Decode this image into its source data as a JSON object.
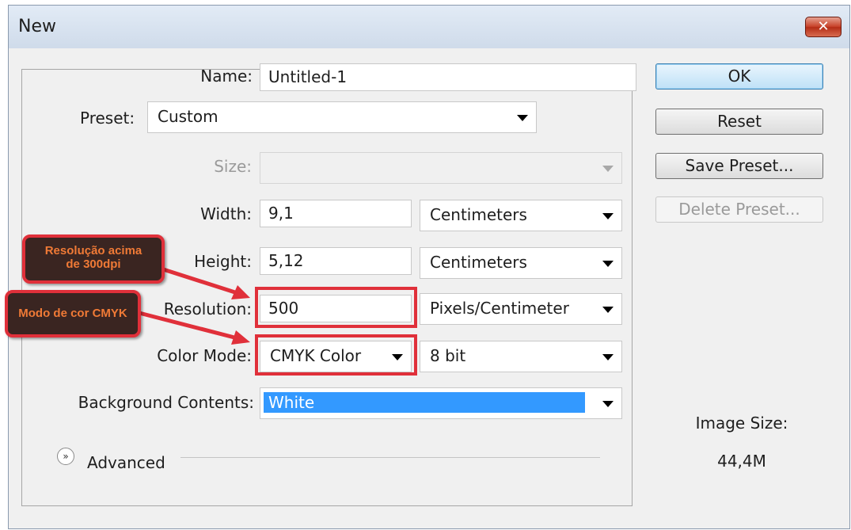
{
  "window": {
    "title": "New",
    "close_label": "✕"
  },
  "form": {
    "name_label": "Name:",
    "name_value": "Untitled-1",
    "preset_label": "Preset:",
    "preset_value": "Custom",
    "size_label": "Size:",
    "size_value": "",
    "width_label": "Width:",
    "width_value": "9,1",
    "width_unit": "Centimeters",
    "height_label": "Height:",
    "height_value": "5,12",
    "height_unit": "Centimeters",
    "resolution_label": "Resolution:",
    "resolution_value": "500",
    "resolution_unit": "Pixels/Centimeter",
    "colormode_label": "Color Mode:",
    "colormode_value": "CMYK Color",
    "bitdepth_value": "8 bit",
    "background_label": "Background Contents:",
    "background_value": "White",
    "advanced_label": "Advanced"
  },
  "buttons": {
    "ok": "OK",
    "reset": "Reset",
    "save_preset": "Save Preset...",
    "delete_preset": "Delete Preset..."
  },
  "image_size": {
    "label": "Image Size:",
    "value": "44,4M"
  },
  "annotations": {
    "resolution_note_line1": "Resolução acima",
    "resolution_note_line2": "de 300dpi",
    "colormode_note": "Modo de cor CMYK",
    "highlight_color": "#e0303a"
  },
  "colors": {
    "selection": "#3399ff",
    "dialog_bg": "#f0f0f0",
    "callout_text": "#f07a36",
    "callout_bg": "#3a2521"
  }
}
